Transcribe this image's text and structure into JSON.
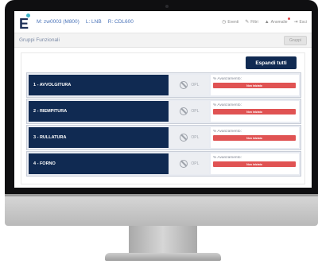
{
  "header": {
    "info_primary": "M: zw0003 (M800)",
    "info_line": "L: LNB",
    "info_code": "R: CDL600",
    "links": [
      {
        "icon": "clock-icon",
        "label": "Eventi"
      },
      {
        "icon": "pencil-icon",
        "label": "Filtri"
      },
      {
        "icon": "warning-icon",
        "label": "Anomalie"
      },
      {
        "icon": "logout-icon",
        "label": "Esci"
      }
    ]
  },
  "subbar": {
    "title": "Gruppi Funzionali",
    "button_label": "Gruppi"
  },
  "main": {
    "expand_label": "Espandi tutti",
    "groups": [
      {
        "name": "1 - AVVOLGITURA",
        "opl": "OPL",
        "progress_label": "% Avanzamento:",
        "status": "Non iniziato"
      },
      {
        "name": "2 - RIEMPITURA",
        "opl": "OPL",
        "progress_label": "% Avanzamento:",
        "status": "Non iniziato"
      },
      {
        "name": "3 - RULLATURA",
        "opl": "OPL",
        "progress_label": "% Avanzamento:",
        "status": "Non iniziato"
      },
      {
        "name": "4 - FORNO",
        "opl": "OPL",
        "progress_label": "% Avanzamento:",
        "status": "Non iniziato"
      }
    ]
  },
  "colors": {
    "navy": "#102a52",
    "accent_blue": "#4a73b8",
    "status_red": "#e05353"
  }
}
